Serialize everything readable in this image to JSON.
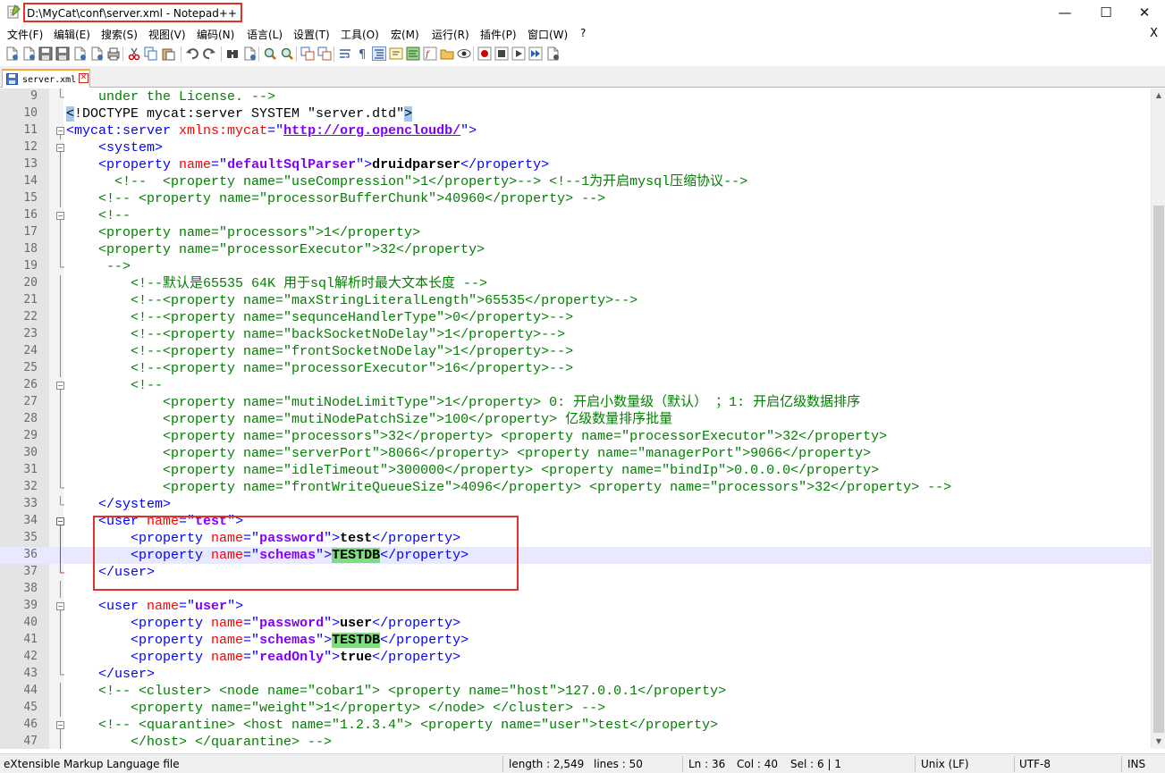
{
  "window": {
    "title": "D:\\MyCat\\conf\\server.xml - Notepad++",
    "minimize": "—",
    "maximize": "☐",
    "close": "✕"
  },
  "menu": {
    "items": [
      "文件(F)",
      "编辑(E)",
      "搜索(S)",
      "视图(V)",
      "编码(N)",
      "语言(L)",
      "设置(T)",
      "工具(O)",
      "宏(M)",
      "运行(R)",
      "插件(P)",
      "窗口(W)",
      "?"
    ],
    "close": "X"
  },
  "toolbar": {
    "icons": [
      "new-file-icon",
      "open-file-icon",
      "save-icon",
      "save-all-icon",
      "close-icon",
      "close-all-icon",
      "print-icon",
      "cut-icon",
      "copy-icon",
      "paste-icon",
      "undo-icon",
      "redo-icon",
      "find-icon",
      "replace-icon",
      "zoom-in-icon",
      "zoom-out-icon",
      "sync-vertical-icon",
      "sync-horizontal-icon",
      "word-wrap-icon",
      "show-all-characters-icon",
      "indent-guide-icon",
      "udl-icon",
      "doc-map-icon",
      "function-list-icon",
      "folder-workspace-icon",
      "monitoring-icon",
      "record-macro-icon",
      "stop-macro-icon",
      "play-macro-icon",
      "run-macro-multiple-icon",
      "save-macro-icon"
    ]
  },
  "tabs": [
    {
      "label": "server.xml",
      "active": true
    }
  ],
  "colors": {
    "comment": "#008000",
    "tag": "#0000ff",
    "attribute": "#ff0000",
    "value": "#8000ff",
    "highlight": "#7fdc7f",
    "annotation": "#e0312b"
  },
  "editor": {
    "current_line": 36,
    "lines": [
      {
        "n": "9",
        "fold": "end",
        "tokens": [
          [
            "c",
            "    under the License. -->"
          ]
        ]
      },
      {
        "n": "10",
        "fold": "none",
        "tokens": [
          [
            "bh",
            "<"
          ],
          [
            "dt",
            "!DOCTYPE mycat:server SYSTEM \"server.dtd\""
          ],
          [
            "bh",
            ">"
          ]
        ]
      },
      {
        "n": "11",
        "fold": "box",
        "tokens": [
          [
            "t",
            "<mycat:server "
          ],
          [
            "a",
            "xmlns:mycat"
          ],
          [
            "t",
            "=\""
          ],
          [
            "u",
            "http://org.opencloudb/"
          ],
          [
            "t",
            "\">"
          ]
        ]
      },
      {
        "n": "12",
        "fold": "box",
        "tokens": [
          [
            "t",
            "    <system>"
          ]
        ]
      },
      {
        "n": "13",
        "fold": "line",
        "tokens": [
          [
            "t",
            "    <property "
          ],
          [
            "a",
            "name"
          ],
          [
            "t",
            "=\""
          ],
          [
            "v",
            "defaultSqlParser"
          ],
          [
            "t",
            "\">"
          ],
          [
            "b",
            "druidparser"
          ],
          [
            "t",
            "</property>"
          ]
        ]
      },
      {
        "n": "14",
        "fold": "line",
        "tokens": [
          [
            "c",
            "      <!--  <property name=\"useCompression\">1</property>--> <!--1为开启mysql压缩协议-->"
          ]
        ]
      },
      {
        "n": "15",
        "fold": "line",
        "tokens": [
          [
            "c",
            "    <!-- <property name=\"processorBufferChunk\">40960</property> -->"
          ]
        ]
      },
      {
        "n": "16",
        "fold": "box",
        "tokens": [
          [
            "c",
            "    <!--"
          ]
        ]
      },
      {
        "n": "17",
        "fold": "line",
        "tokens": [
          [
            "c",
            "    <property name=\"processors\">1</property>"
          ]
        ]
      },
      {
        "n": "18",
        "fold": "line",
        "tokens": [
          [
            "c",
            "    <property name=\"processorExecutor\">32</property>"
          ]
        ]
      },
      {
        "n": "19",
        "fold": "end",
        "tokens": [
          [
            "c",
            "     -->"
          ]
        ]
      },
      {
        "n": "20",
        "fold": "line",
        "tokens": [
          [
            "c",
            "        <!--默认是65535 64K 用于sql解析时最大文本长度 -->"
          ]
        ]
      },
      {
        "n": "21",
        "fold": "line",
        "tokens": [
          [
            "c",
            "        <!--<property name=\"maxStringLiteralLength\">65535</property>-->"
          ]
        ]
      },
      {
        "n": "22",
        "fold": "line",
        "tokens": [
          [
            "c",
            "        <!--<property name=\"sequnceHandlerType\">0</property>-->"
          ]
        ]
      },
      {
        "n": "23",
        "fold": "line",
        "tokens": [
          [
            "c",
            "        <!--<property name=\"backSocketNoDelay\">1</property>-->"
          ]
        ]
      },
      {
        "n": "24",
        "fold": "line",
        "tokens": [
          [
            "c",
            "        <!--<property name=\"frontSocketNoDelay\">1</property>-->"
          ]
        ]
      },
      {
        "n": "25",
        "fold": "line",
        "tokens": [
          [
            "c",
            "        <!--<property name=\"processorExecutor\">16</property>-->"
          ]
        ]
      },
      {
        "n": "26",
        "fold": "box",
        "tokens": [
          [
            "c",
            "        <!--"
          ]
        ]
      },
      {
        "n": "27",
        "fold": "line",
        "tokens": [
          [
            "c",
            "            <property name=\"mutiNodeLimitType\">1</property> 0: 开启小数量级（默认） ；1: 开启亿级数据排序"
          ]
        ]
      },
      {
        "n": "28",
        "fold": "line",
        "tokens": [
          [
            "c",
            "            <property name=\"mutiNodePatchSize\">100</property> 亿级数量排序批量"
          ]
        ]
      },
      {
        "n": "29",
        "fold": "line",
        "tokens": [
          [
            "c",
            "            <property name=\"processors\">32</property> <property name=\"processorExecutor\">32</property>"
          ]
        ]
      },
      {
        "n": "30",
        "fold": "line",
        "tokens": [
          [
            "c",
            "            <property name=\"serverPort\">8066</property> <property name=\"managerPort\">9066</property>"
          ]
        ]
      },
      {
        "n": "31",
        "fold": "line",
        "tokens": [
          [
            "c",
            "            <property name=\"idleTimeout\">300000</property> <property name=\"bindIp\">0.0.0.0</property>"
          ]
        ]
      },
      {
        "n": "32",
        "fold": "end",
        "tokens": [
          [
            "c",
            "            <property name=\"frontWriteQueueSize\">4096</property> <property name=\"processors\">32</property> -->"
          ]
        ]
      },
      {
        "n": "33",
        "fold": "end",
        "tokens": [
          [
            "t",
            "    </system>"
          ]
        ]
      },
      {
        "n": "34",
        "fold": "boxred",
        "tokens": [
          [
            "t",
            "    <user "
          ],
          [
            "a",
            "name"
          ],
          [
            "t",
            "=\""
          ],
          [
            "v",
            "test"
          ],
          [
            "t",
            "\">"
          ]
        ]
      },
      {
        "n": "35",
        "fold": "linered",
        "tokens": [
          [
            "t",
            "        <property "
          ],
          [
            "a",
            "name"
          ],
          [
            "t",
            "=\""
          ],
          [
            "v",
            "password"
          ],
          [
            "t",
            "\">"
          ],
          [
            "b",
            "test"
          ],
          [
            "t",
            "</property>"
          ]
        ]
      },
      {
        "n": "36",
        "fold": "linered",
        "tokens": [
          [
            "t",
            "        <property "
          ],
          [
            "a",
            "name"
          ],
          [
            "t",
            "=\""
          ],
          [
            "v",
            "schemas"
          ],
          [
            "t",
            "\">"
          ],
          [
            "bhl",
            "TESTDB"
          ],
          [
            "t",
            "</property>"
          ]
        ]
      },
      {
        "n": "37",
        "fold": "endred",
        "tokens": [
          [
            "t",
            "    </user>"
          ]
        ]
      },
      {
        "n": "38",
        "fold": "line",
        "tokens": []
      },
      {
        "n": "39",
        "fold": "box",
        "tokens": [
          [
            "t",
            "    <user "
          ],
          [
            "a",
            "name"
          ],
          [
            "t",
            "=\""
          ],
          [
            "v",
            "user"
          ],
          [
            "t",
            "\">"
          ]
        ]
      },
      {
        "n": "40",
        "fold": "line",
        "tokens": [
          [
            "t",
            "        <property "
          ],
          [
            "a",
            "name"
          ],
          [
            "t",
            "=\""
          ],
          [
            "v",
            "password"
          ],
          [
            "t",
            "\">"
          ],
          [
            "b",
            "user"
          ],
          [
            "t",
            "</property>"
          ]
        ]
      },
      {
        "n": "41",
        "fold": "line",
        "tokens": [
          [
            "t",
            "        <property "
          ],
          [
            "a",
            "name"
          ],
          [
            "t",
            "=\""
          ],
          [
            "v",
            "schemas"
          ],
          [
            "t",
            "\">"
          ],
          [
            "bhl",
            "TESTDB"
          ],
          [
            "t",
            "</property>"
          ]
        ]
      },
      {
        "n": "42",
        "fold": "line",
        "tokens": [
          [
            "t",
            "        <property "
          ],
          [
            "a",
            "name"
          ],
          [
            "t",
            "=\""
          ],
          [
            "v",
            "readOnly"
          ],
          [
            "t",
            "\">"
          ],
          [
            "b",
            "true"
          ],
          [
            "t",
            "</property>"
          ]
        ]
      },
      {
        "n": "43",
        "fold": "end",
        "tokens": [
          [
            "t",
            "    </user>"
          ]
        ]
      },
      {
        "n": "44",
        "fold": "line",
        "tokens": [
          [
            "c",
            "    <!-- <cluster> <node name=\"cobar1\"> <property name=\"host\">127.0.0.1</property>"
          ]
        ]
      },
      {
        "n": "45",
        "fold": "line",
        "tokens": [
          [
            "c",
            "        <property name=\"weight\">1</property> </node> </cluster> -->"
          ]
        ]
      },
      {
        "n": "46",
        "fold": "box",
        "tokens": [
          [
            "c",
            "    <!-- <quarantine> <host name=\"1.2.3.4\"> <property name=\"user\">test</property>"
          ]
        ]
      },
      {
        "n": "47",
        "fold": "line",
        "tokens": [
          [
            "c",
            "        </host> </quarantine> -->"
          ]
        ]
      }
    ]
  },
  "status": {
    "filetype": "eXtensible Markup Language file",
    "length": "length : 2,549",
    "lines": "lines : 50",
    "ln": "Ln : 36",
    "col": "Col : 40",
    "sel": "Sel : 6 | 1",
    "eol": "Unix (LF)",
    "encoding": "UTF-8",
    "mode": "INS"
  }
}
